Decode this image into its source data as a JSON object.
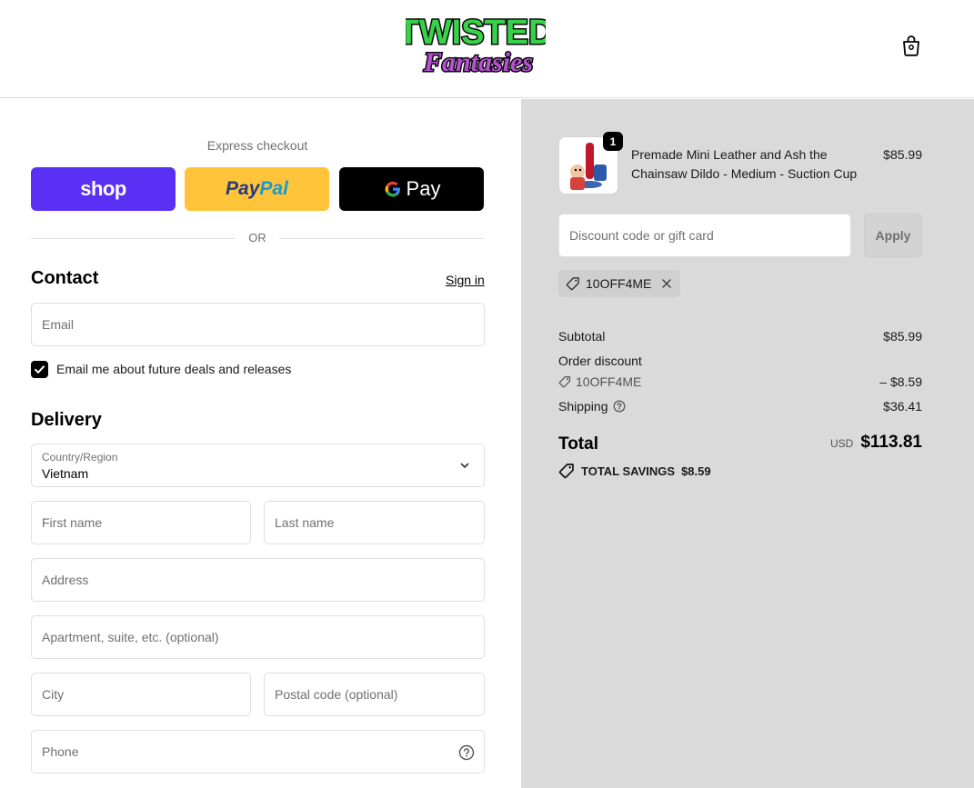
{
  "header": {
    "brand_line1": "TWISTED",
    "brand_line2": "Fantasies",
    "cart_icon": "shopping-bag-icon"
  },
  "express": {
    "title": "Express checkout",
    "shop_label": "shop",
    "paypal_label_1": "Pay",
    "paypal_label_2": "Pal",
    "gpay_label": "Pay",
    "or_label": "OR",
    "colors": {
      "shop": "#5a31f4",
      "paypal": "#ffc439",
      "gpay": "#000000"
    }
  },
  "contact": {
    "title": "Contact",
    "signin_label": "Sign in",
    "email_placeholder": "Email",
    "newsletter_label": "Email me about future deals and releases",
    "newsletter_checked": true
  },
  "delivery": {
    "title": "Delivery",
    "country_label": "Country/Region",
    "country_value": "Vietnam",
    "first_name_placeholder": "First name",
    "last_name_placeholder": "Last name",
    "address_placeholder": "Address",
    "apartment_placeholder": "Apartment, suite, etc. (optional)",
    "city_placeholder": "City",
    "postal_placeholder": "Postal code (optional)",
    "phone_placeholder": "Phone"
  },
  "order": {
    "item": {
      "quantity": "1",
      "name": "Premade Mini Leather and Ash the Chainsaw Dildo - Medium - Suction Cup",
      "price": "$85.99"
    },
    "discount_placeholder": "Discount code or gift card",
    "apply_label": "Apply",
    "applied_code": "10OFF4ME",
    "subtotal_label": "Subtotal",
    "subtotal_value": "$85.99",
    "order_discount_label": "Order discount",
    "discount_code": "10OFF4ME",
    "discount_value": "– $8.59",
    "shipping_label": "Shipping",
    "shipping_value": "$36.41",
    "total_label": "Total",
    "total_currency": "USD",
    "total_value": "$113.81",
    "savings_label": "TOTAL SAVINGS",
    "savings_value": "$8.59"
  }
}
